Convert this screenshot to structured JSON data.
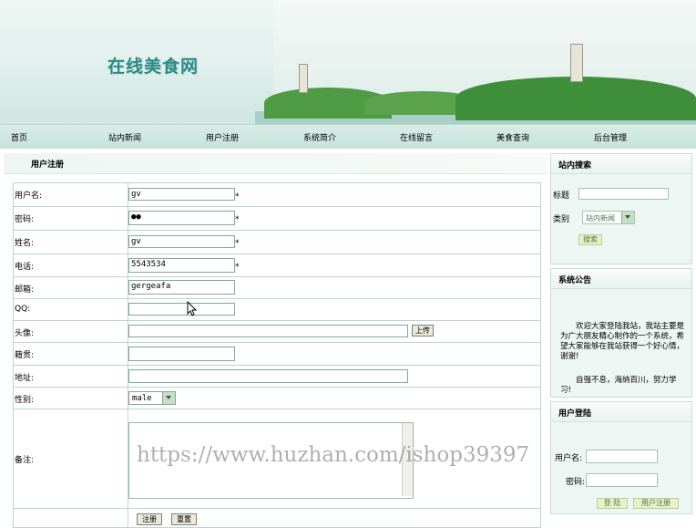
{
  "site": {
    "title": "在线美食网"
  },
  "nav": [
    "首页",
    "站内新闻",
    "用户注册",
    "系统简介",
    "在线留言",
    "美食查询",
    "后台管理"
  ],
  "panel": {
    "title": "用户注册"
  },
  "form": {
    "username": {
      "label": "用户名:",
      "value": "gv",
      "required": "*"
    },
    "password": {
      "label": "密码:",
      "value": "●●",
      "required": "*"
    },
    "name": {
      "label": "姓名:",
      "value": "gv",
      "required": "*"
    },
    "phone": {
      "label": "电话:",
      "value": "5543534",
      "required": "*"
    },
    "email": {
      "label": "邮箱:",
      "value": "gergeafa"
    },
    "qq": {
      "label": "QQ:",
      "value": ""
    },
    "avatar": {
      "label": "头像:",
      "value": "",
      "upload_label": "上传"
    },
    "hometown": {
      "label": "籍贯:",
      "value": ""
    },
    "address": {
      "label": "地址:",
      "value": ""
    },
    "gender": {
      "label": "性别:",
      "value": "male"
    },
    "remark": {
      "label": "备注:",
      "value": ""
    },
    "buttons": {
      "submit": "注册",
      "reset": "重置"
    }
  },
  "search": {
    "title": "站内搜索",
    "title_label": "标题",
    "category_label": "类别",
    "category_value": "站内新闻",
    "button": "搜索"
  },
  "notice": {
    "title": "系统公告",
    "text1": "欢迎大家登陆我站，我站主要是为广大朋友精心制作的一个系统，希望大家能够在我站获得一个好心情，谢谢!",
    "text2": "自强不息，海纳百川，努力学习!"
  },
  "login": {
    "title": "用户登陆",
    "username_label": "用户名:",
    "password_label": "密码:",
    "login_button": "登 陆",
    "register_button": "用户注册"
  },
  "watermark": "https://www.huzhan.com/ishop39397",
  "colors": {
    "theme": "#c9e2dc",
    "border": "#b9d6cc",
    "title": "#2f8a86"
  }
}
